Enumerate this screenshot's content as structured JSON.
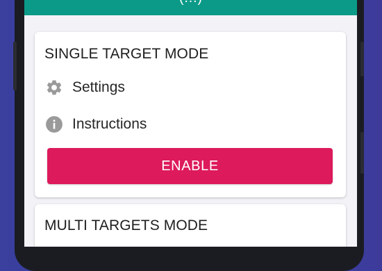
{
  "app_bar": {
    "title": "(…)",
    "color": "#0b9a88"
  },
  "single_target": {
    "title": "SINGLE TARGET MODE",
    "items": [
      {
        "label": "Settings",
        "icon": "gear-icon"
      },
      {
        "label": "Instructions",
        "icon": "info-icon"
      }
    ],
    "button_label": "ENABLE",
    "button_color": "#dd1a5c"
  },
  "multi_targets": {
    "title": "MULTI TARGETS MODE"
  }
}
